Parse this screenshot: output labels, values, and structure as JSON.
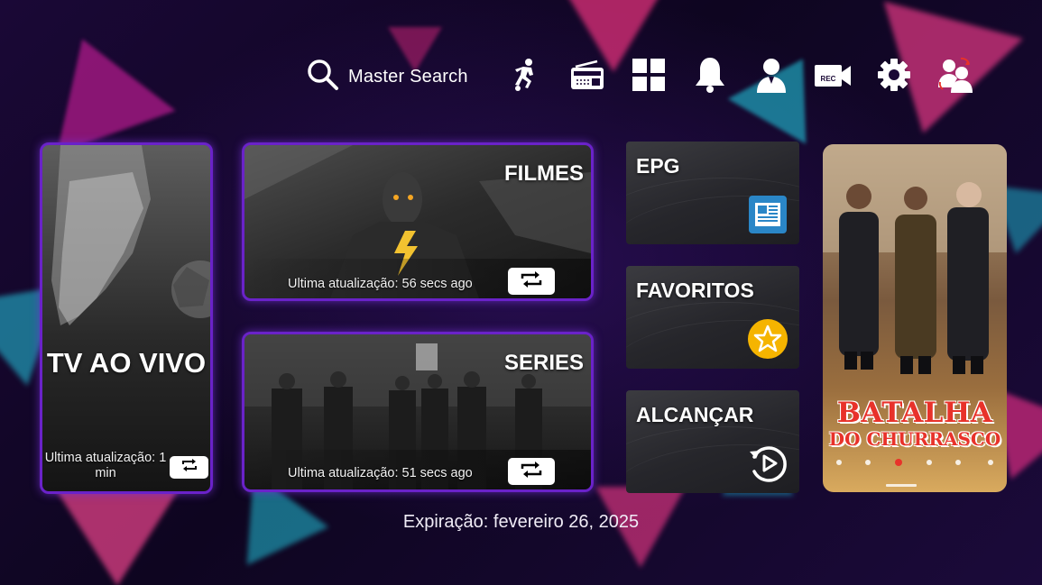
{
  "header": {
    "search_label": "Master Search",
    "icons": [
      "search-icon",
      "sports-player-icon",
      "radio-icon",
      "grid-apps-icon",
      "bell-icon",
      "user-icon",
      "rec-camera-icon",
      "gear-icon",
      "switch-user-icon"
    ],
    "rec_label": "REC"
  },
  "cards": {
    "live": {
      "title": "TV AO VIVO",
      "update": "Ultima atualização: 1 min"
    },
    "films": {
      "title": "FILMES",
      "update": "Ultima atualização: 56 secs ago"
    },
    "series": {
      "title": "SERIES",
      "update": "Ultima atualização: 51 secs ago"
    },
    "epg": {
      "title": "EPG",
      "icon": "newspaper-icon"
    },
    "favorites": {
      "title": "FAVORITOS",
      "icon": "star-icon"
    },
    "catchup": {
      "title": "ALCANÇAR",
      "icon": "replay-icon"
    },
    "poster": {
      "line1": "BATALHA",
      "line2": "DO CHURRASCO"
    }
  },
  "footer": {
    "expiry": "Expiração: fevereiro 26, 2025"
  },
  "colors": {
    "card_border": "#6a22c9",
    "accent_blue": "#2a86c7",
    "accent_yellow": "#f5b400",
    "poster_red": "#e8322a"
  }
}
